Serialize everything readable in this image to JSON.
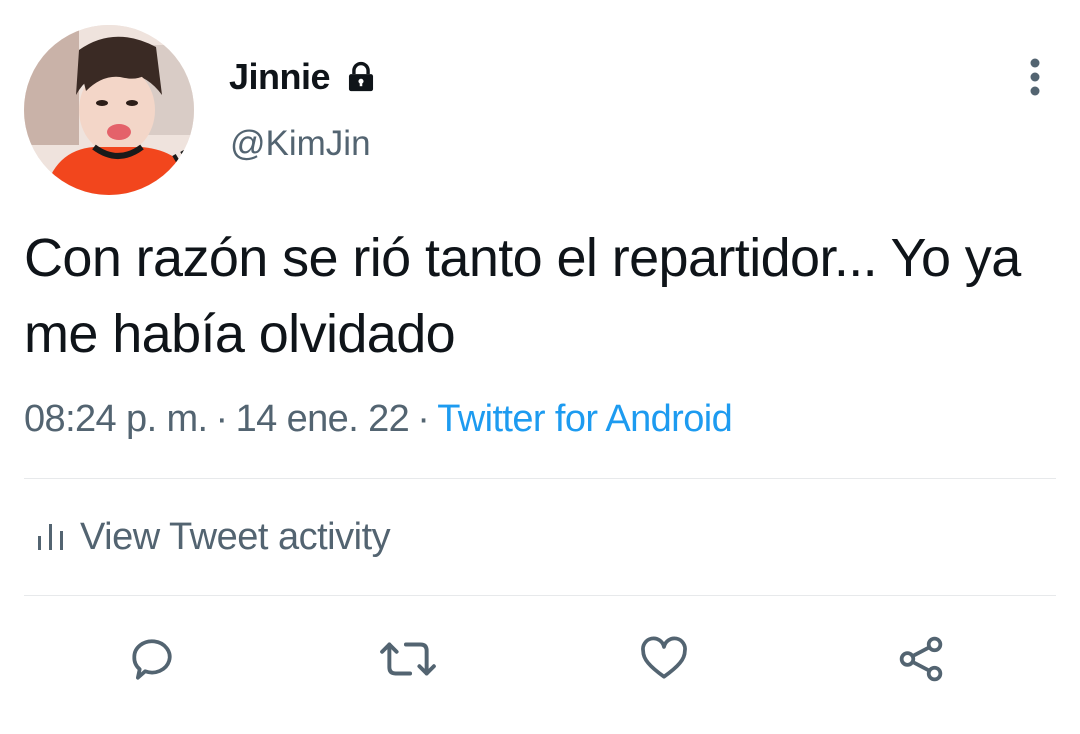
{
  "author": {
    "display_name": "Jinnie",
    "handle": "@KimJin",
    "protected_icon": "lock-icon",
    "avatar_icon": "avatar-photo"
  },
  "tweet": {
    "text": "Con razón se rió tanto el repartidor... Yo ya me había olvidado",
    "time": "08:24 p. m.",
    "date": "14 ene. 22",
    "source": "Twitter for Android",
    "separator": "·"
  },
  "activity": {
    "label": "View Tweet activity",
    "icon": "bar-chart-icon"
  },
  "actions": [
    {
      "name": "reply",
      "icon": "reply-icon"
    },
    {
      "name": "retweet",
      "icon": "retweet-icon"
    },
    {
      "name": "like",
      "icon": "heart-icon"
    },
    {
      "name": "share",
      "icon": "share-icon"
    }
  ],
  "more_menu_icon": "more-vertical-icon",
  "colors": {
    "text_primary": "#0f1419",
    "text_secondary": "#536471",
    "link": "#1d9bf0",
    "divider": "#e7e9eb",
    "icon": "#536471"
  }
}
